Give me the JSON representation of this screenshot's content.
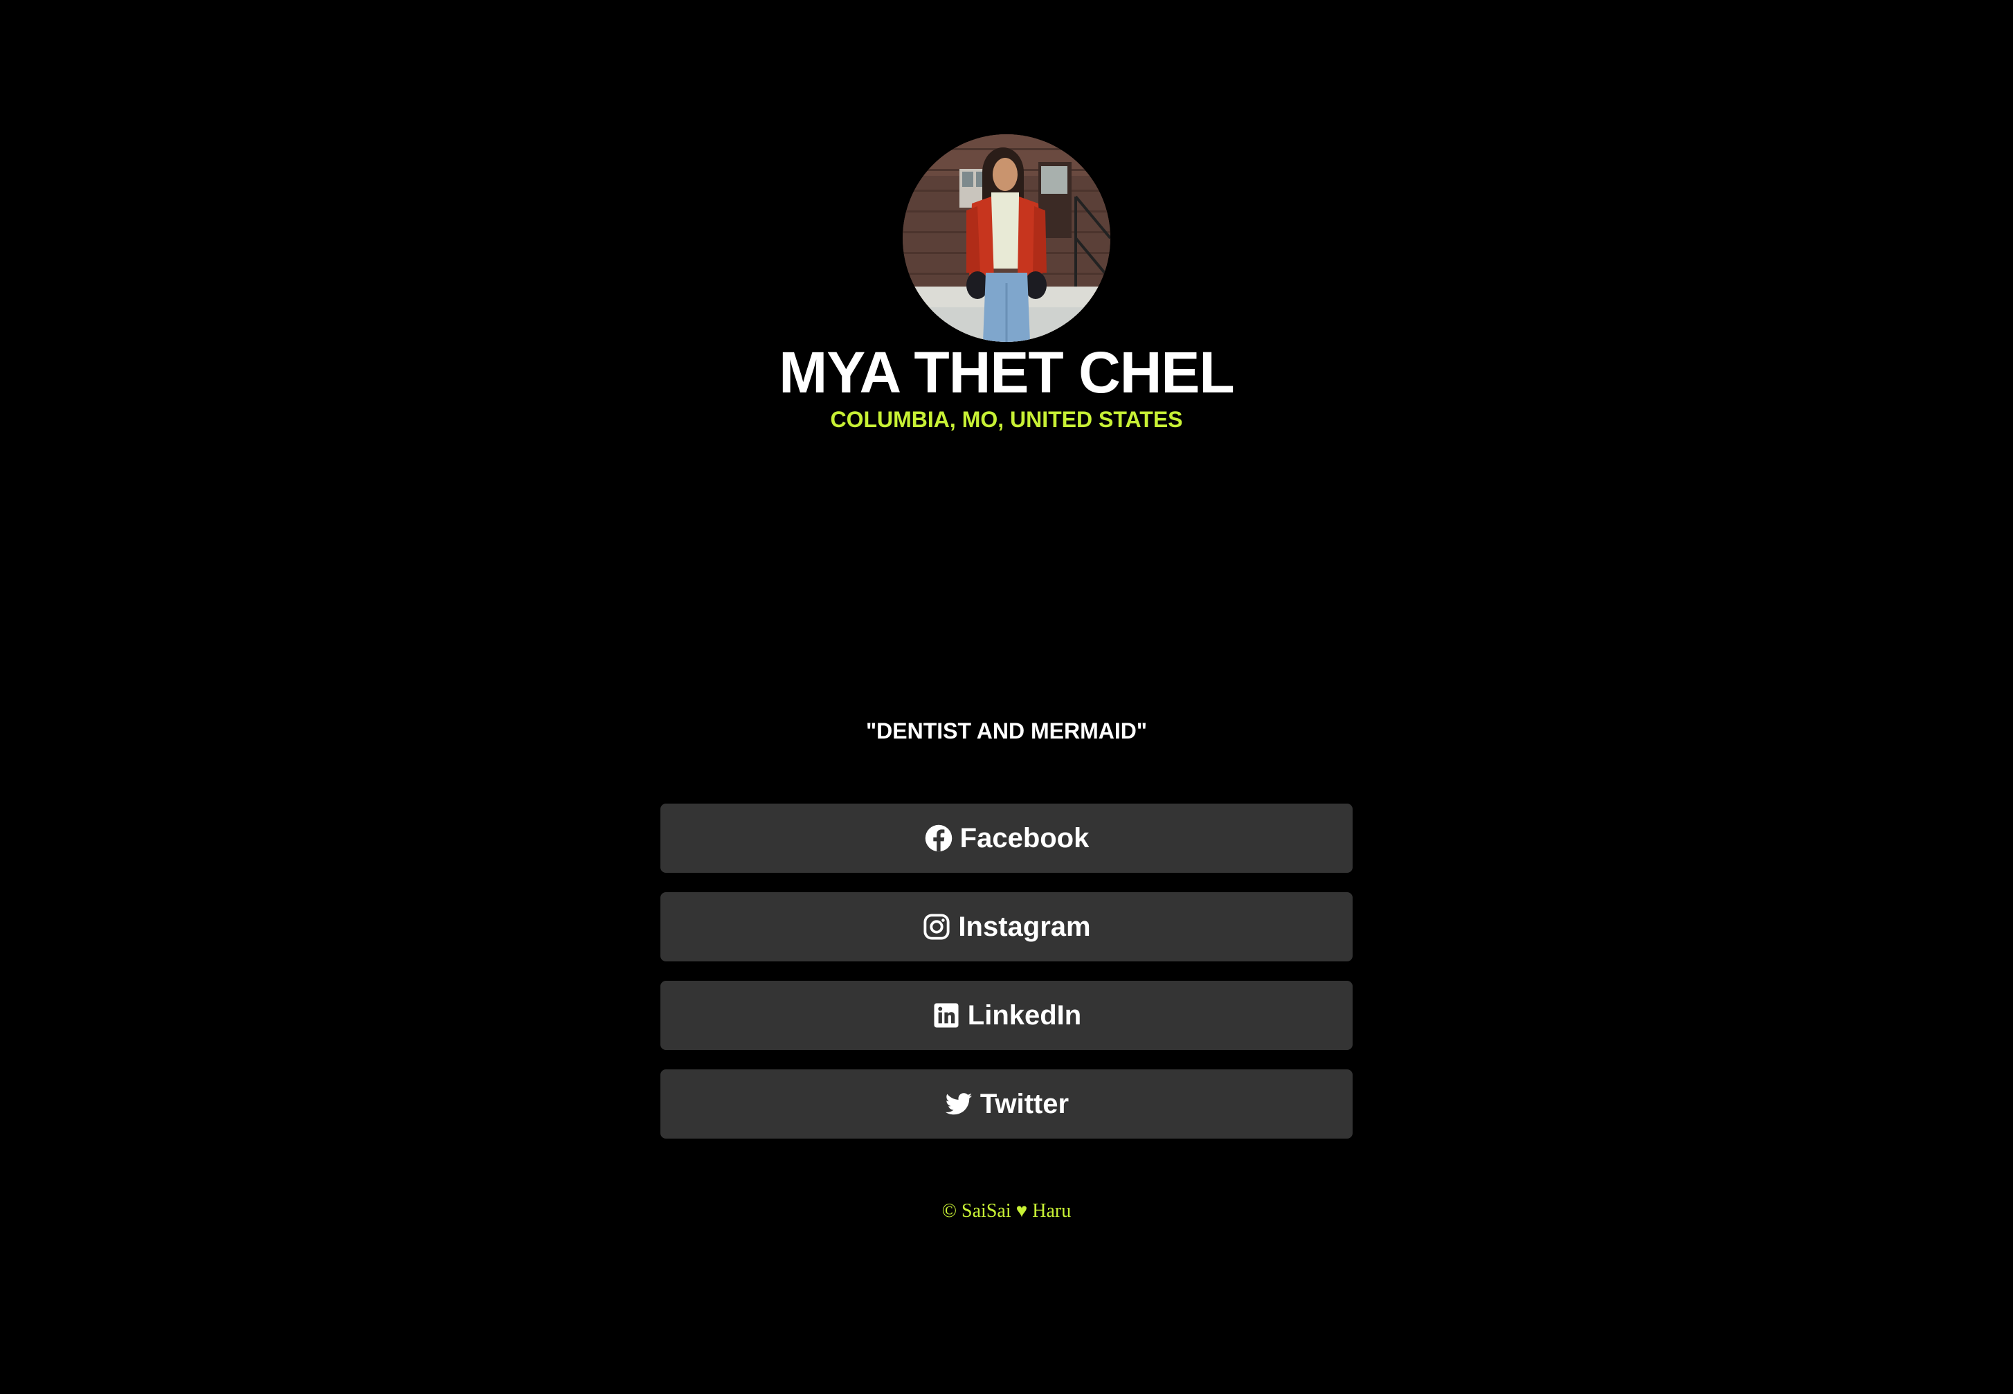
{
  "profile": {
    "name": "MYA THET CHEL",
    "location": "COLUMBIA, MO, UNITED STATES",
    "bio": "\"DENTIST AND MERMAID\"",
    "avatar_icon": "profile-photo"
  },
  "links": [
    {
      "label": "Facebook",
      "icon": "facebook-icon"
    },
    {
      "label": "Instagram",
      "icon": "instagram-icon"
    },
    {
      "label": "LinkedIn",
      "icon": "linkedin-icon"
    },
    {
      "label": "Twitter",
      "icon": "twitter-icon"
    }
  ],
  "footer": {
    "text": "© SaiSai ♥ Haru"
  },
  "colors": {
    "background": "#000000",
    "accent": "#c8f135",
    "button": "#343434",
    "text": "#ffffff"
  }
}
